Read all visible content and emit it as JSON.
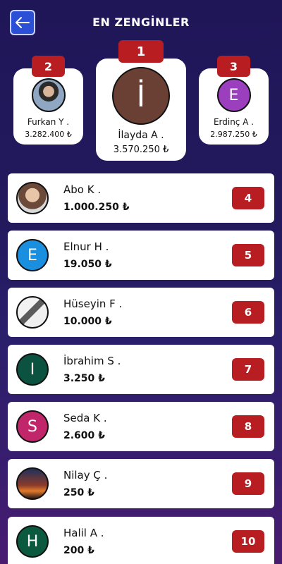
{
  "header": {
    "title": "EN ZENGİNLER",
    "back_icon": "arrow-left-icon"
  },
  "colors": {
    "rank_red": "#b81d22",
    "back_blue": "#2b50d6"
  },
  "podium": [
    {
      "rank": "2",
      "name": "Furkan Y .",
      "amount": "3.282.400 ₺",
      "avatar_type": "photo"
    },
    {
      "rank": "1",
      "name": "İlayda A .",
      "amount": "3.570.250 ₺",
      "avatar_letter": "İ",
      "avatar_color": "#6b4034"
    },
    {
      "rank": "3",
      "name": "Erdinç A .",
      "amount": "2.987.250 ₺",
      "avatar_letter": "E",
      "avatar_color": "#9c3fbf"
    }
  ],
  "rows": [
    {
      "rank": "4",
      "name": "Abo K .",
      "amount": "1.000.250 ₺",
      "avatar_type": "photo"
    },
    {
      "rank": "5",
      "name": "Elnur H .",
      "amount": "19.050 ₺",
      "avatar_letter": "E",
      "avatar_color": "#1a8fe0"
    },
    {
      "rank": "6",
      "name": "Hüseyin F .",
      "amount": "10.000 ₺",
      "avatar_type": "photo"
    },
    {
      "rank": "7",
      "name": "İbrahim S .",
      "amount": "3.250 ₺",
      "avatar_letter": "I",
      "avatar_color": "#0b5240"
    },
    {
      "rank": "8",
      "name": "Seda K .",
      "amount": "2.600 ₺",
      "avatar_letter": "S",
      "avatar_color": "#c2266a"
    },
    {
      "rank": "9",
      "name": "Nilay Ç .",
      "amount": "250 ₺",
      "avatar_type": "photo"
    },
    {
      "rank": "10",
      "name": "Halil A .",
      "amount": "200 ₺",
      "avatar_letter": "H",
      "avatar_color": "#0b5a40"
    }
  ]
}
